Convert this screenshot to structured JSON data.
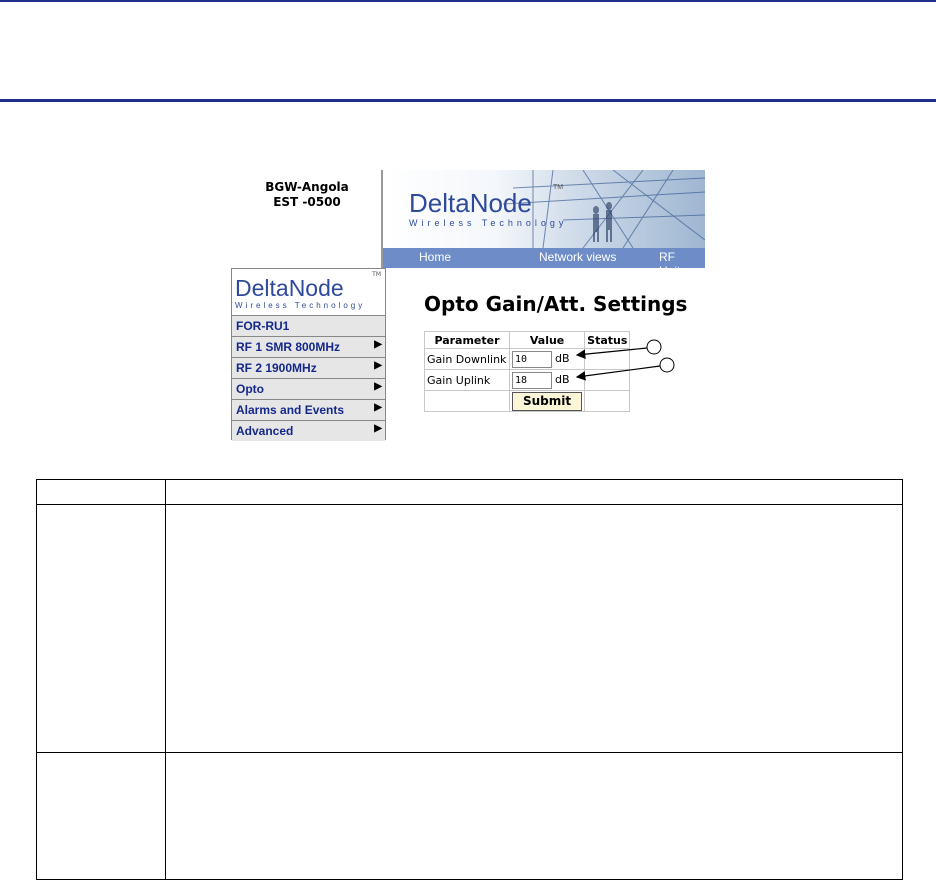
{
  "site": {
    "name": "BGW-Angola",
    "timezone": "EST -0500"
  },
  "brand": {
    "logo_text": "DeltaNode",
    "logo_sub": "Wireless Technology",
    "tm": "TM"
  },
  "nav": {
    "items": [
      "Home",
      "Network views",
      "RF Units"
    ]
  },
  "sidebar": {
    "items": [
      {
        "label": "FOR-RU1",
        "arrow": ""
      },
      {
        "label": "RF 1 SMR 800MHz",
        "arrow": "▶"
      },
      {
        "label": "RF 2 1900MHz",
        "arrow": "▶"
      },
      {
        "label": "Opto",
        "arrow": "▶"
      },
      {
        "label": "Alarms and Events",
        "arrow": "▶"
      },
      {
        "label": "Advanced",
        "arrow": "▶"
      }
    ]
  },
  "panel": {
    "title": "Opto Gain/Att. Settings",
    "headers": [
      "Parameter",
      "Value",
      "Status"
    ],
    "rows": [
      {
        "param": "Gain Downlink",
        "value": "10",
        "unit": "dB"
      },
      {
        "param": "Gain Uplink",
        "value": "18",
        "unit": "dB"
      }
    ],
    "submit_label": "Submit"
  },
  "colors": {
    "rule": "#1f2f8a",
    "nav_bar": "#6e8cc7",
    "menu_text": "#14288a",
    "menu_bg": "#e6e6e6"
  }
}
